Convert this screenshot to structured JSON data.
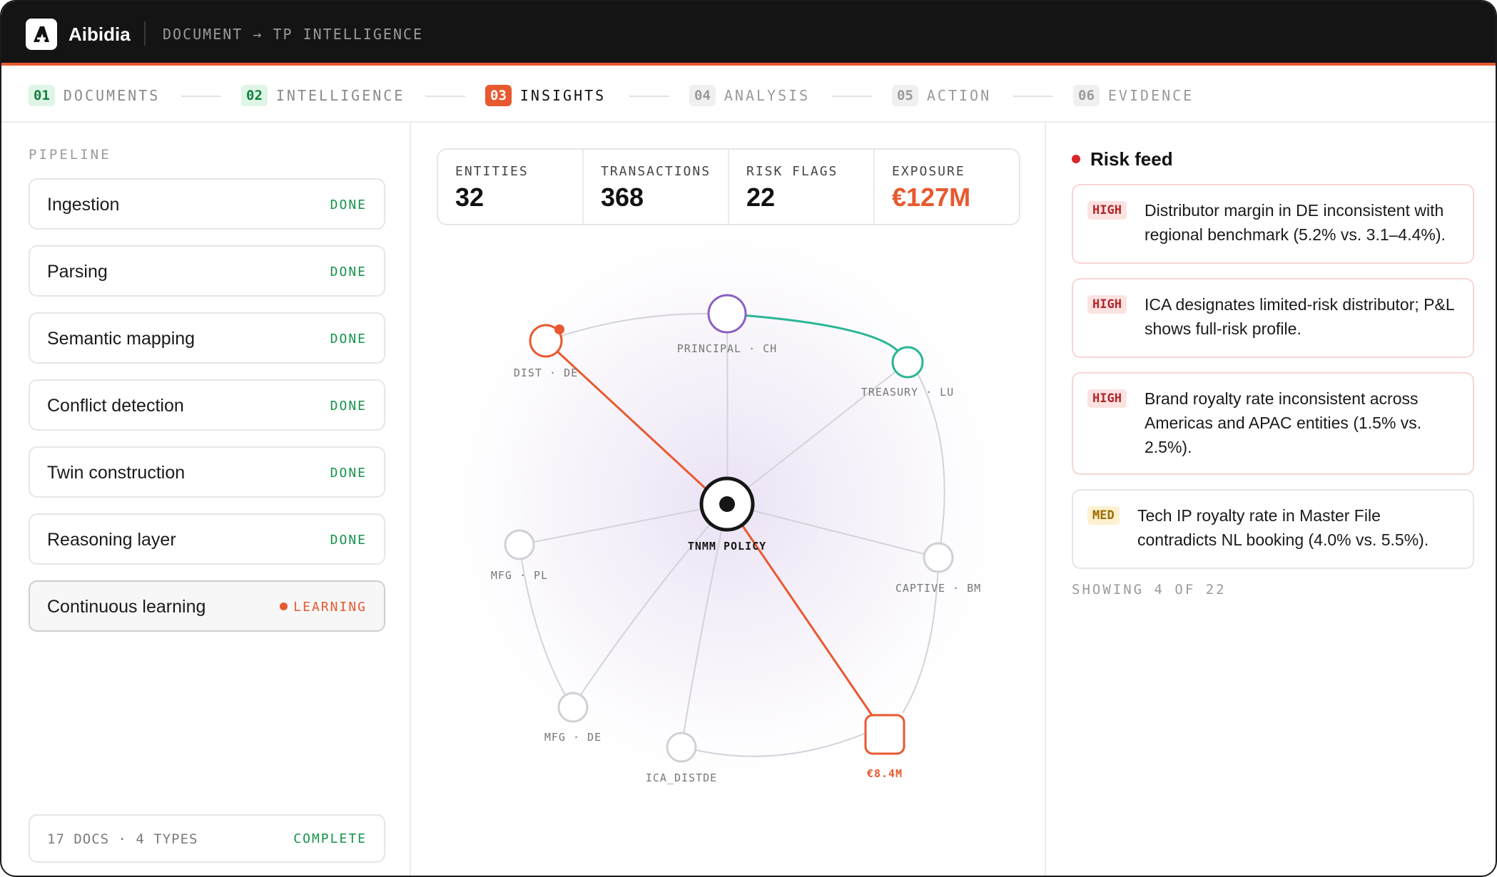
{
  "header": {
    "brand": "Aibidia",
    "breadcrumb": "DOCUMENT → TP INTELLIGENCE"
  },
  "steps": [
    {
      "num": "01",
      "label": "DOCUMENTS",
      "state": "done"
    },
    {
      "num": "02",
      "label": "INTELLIGENCE",
      "state": "done"
    },
    {
      "num": "03",
      "label": "INSIGHTS",
      "state": "active"
    },
    {
      "num": "04",
      "label": "ANALYSIS",
      "state": "todo"
    },
    {
      "num": "05",
      "label": "ACTION",
      "state": "todo"
    },
    {
      "num": "06",
      "label": "EVIDENCE",
      "state": "todo"
    }
  ],
  "pipeline": {
    "title": "PIPELINE",
    "items": [
      {
        "name": "Ingestion",
        "status": "DONE"
      },
      {
        "name": "Parsing",
        "status": "DONE"
      },
      {
        "name": "Semantic mapping",
        "status": "DONE"
      },
      {
        "name": "Conflict detection",
        "status": "DONE"
      },
      {
        "name": "Twin construction",
        "status": "DONE"
      },
      {
        "name": "Reasoning layer",
        "status": "DONE"
      },
      {
        "name": "Continuous learning",
        "status": "LEARNING"
      }
    ],
    "footer_left": "17 DOCS · 4 TYPES",
    "footer_right": "COMPLETE"
  },
  "stats": [
    {
      "label": "ENTITIES",
      "value": "32"
    },
    {
      "label": "TRANSACTIONS",
      "value": "368"
    },
    {
      "label": "RISK FLAGS",
      "value": "22"
    },
    {
      "label": "EXPOSURE",
      "value": "€127M"
    }
  ],
  "graph": {
    "center_label": "TNMM POLICY",
    "nodes": {
      "dist_de": "DIST · DE",
      "principal_ch": "PRINCIPAL · CH",
      "treasury_lu": "TREASURY · LU",
      "mfg_pl": "MFG · PL",
      "captive_bm": "CAPTIVE · BM",
      "mfg_de": "MFG · DE",
      "ica_distde": "ICA_DISTDE",
      "exposure": "€8.4M"
    },
    "colors": {
      "risk": "#e8592f",
      "principal": "#8b5fc0",
      "treasury": "#2bb596",
      "neutral": "#d0d0d6"
    }
  },
  "feed": {
    "title": "Risk feed",
    "items": [
      {
        "severity": "HIGH",
        "text": "Distributor margin in DE inconsistent with regional benchmark (5.2% vs. 3.1–4.4%)."
      },
      {
        "severity": "HIGH",
        "text": "ICA designates limited-risk distributor; P&L shows full-risk profile."
      },
      {
        "severity": "HIGH",
        "text": "Brand royalty rate inconsistent across Americas and APAC entities (1.5% vs. 2.5%)."
      },
      {
        "severity": "MED",
        "text": "Tech IP royalty rate in Master File contradicts NL booking (4.0% vs. 5.5%)."
      }
    ],
    "showing": "SHOWING 4 OF 22"
  }
}
